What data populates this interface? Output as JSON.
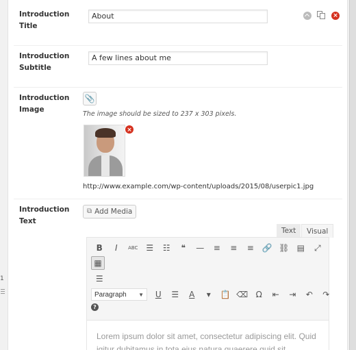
{
  "left_strip": {
    "number": "1",
    "drag_icon": "drag-handle-icon"
  },
  "fields": {
    "title": {
      "label_line1": "Introduction",
      "label_line2": "Title",
      "value": "About"
    },
    "subtitle": {
      "label_line1": "Introduction",
      "label_line2": "Subtitle",
      "value": "A few lines about me"
    },
    "image": {
      "label_line1": "Introduction",
      "label_line2": "Image",
      "attach_icon": "paperclip-icon",
      "hint": "The image should be sized to 237 x 303 pixels.",
      "remove_icon": "remove-image-icon",
      "url": "http://www.example.com/wp-content/uploads/2015/08/userpic1.jpg"
    },
    "text": {
      "label_line1": "Introduction",
      "label_line2": "Text",
      "add_media_label": "Add Media",
      "tabs": [
        "Text",
        "Visual"
      ],
      "active_tab": "Visual",
      "format_select": "Paragraph",
      "content": "Lorem ipsum dolor sit amet, consectetur adipiscing elit. Quid igitur dubitamus in tota eius natura quaerere quid sit effectum"
    }
  },
  "row_actions": {
    "collapse": "collapse-icon",
    "duplicate": "duplicate-icon",
    "delete": "delete-icon"
  },
  "toolbar": {
    "row1": [
      {
        "name": "bold-button",
        "glyph": "B"
      },
      {
        "name": "italic-button",
        "glyph": "I"
      },
      {
        "name": "strikethrough-button",
        "glyph": "ABC"
      },
      {
        "name": "bullet-list-button",
        "glyph": "☰"
      },
      {
        "name": "numbered-list-button",
        "glyph": "☷"
      },
      {
        "name": "blockquote-button",
        "glyph": "❝"
      },
      {
        "name": "horizontal-line-button",
        "glyph": "—"
      },
      {
        "name": "align-left-button",
        "glyph": "≡"
      },
      {
        "name": "align-center-button",
        "glyph": "≡"
      },
      {
        "name": "align-right-button",
        "glyph": "≡"
      },
      {
        "name": "insert-link-button",
        "glyph": "🔗"
      },
      {
        "name": "remove-link-button",
        "glyph": "⛓"
      },
      {
        "name": "read-more-button",
        "glyph": "▤"
      },
      {
        "name": "fullscreen-button",
        "glyph": "⤢"
      }
    ],
    "kitchen_sink": "▦",
    "align_full": "☰",
    "row3": [
      {
        "name": "underline-button",
        "glyph": "U"
      },
      {
        "name": "justify-button",
        "glyph": "☰"
      },
      {
        "name": "text-color-button",
        "glyph": "A"
      },
      {
        "name": "text-color-dropdown",
        "glyph": "▾"
      },
      {
        "name": "paste-text-button",
        "glyph": "📋"
      },
      {
        "name": "clear-formatting-button",
        "glyph": "⌫"
      },
      {
        "name": "special-character-button",
        "glyph": "Ω"
      },
      {
        "name": "outdent-button",
        "glyph": "⇤"
      },
      {
        "name": "indent-button",
        "glyph": "⇥"
      },
      {
        "name": "undo-button",
        "glyph": "↶"
      },
      {
        "name": "redo-button",
        "glyph": "↷"
      }
    ],
    "help": "?"
  }
}
